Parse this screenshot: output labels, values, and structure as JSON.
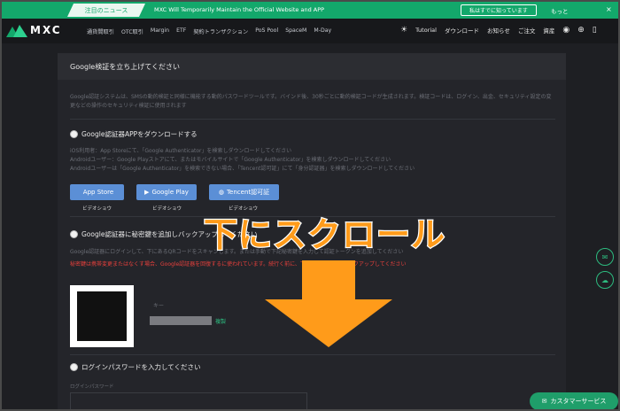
{
  "notice": {
    "tag": "注目のニュース",
    "text": "MXC Will Temporarily Maintain the Official Website and APP",
    "button": "私はすでに知っています",
    "more": "もっと",
    "close_glyph": "×"
  },
  "nav": {
    "logo": "MXC",
    "menu": [
      "通貨間取引",
      "OTC取引",
      "Margin",
      "ETF",
      "契約トランザクション",
      "PoS Pool",
      "SpaceM",
      "M-Day"
    ],
    "right": {
      "theme_icon": "sun-icon",
      "tutorial": "Tutorial",
      "download": "ダウンロード",
      "notice": "お知らせ",
      "orders": "ご注文",
      "assets": "資産"
    }
  },
  "panel": {
    "title": "Google検証を立ち上げてください",
    "description": "Google認証システムは、SMSの動的検証と同様に機能する動的パスワードツールです。バインド後、30秒ごとに動的検証コードが生成されます。検証コードは、ログイン、出金、セキュリティ設定の変更などの操作のセキュリティ検証に使用されます",
    "step1": {
      "label": "Google認証器APPをダウンロードする",
      "lines": [
        "iOS利用者：App Storeにて、「Google Authenticator」を検索しダウンロードしてください",
        "Androidユーザー：Google Playストアにて、またはモバイルサイトで「Google Authenticator」を検索しダウンロードしてください",
        "Androidユーザーは「Google Authenticator」を検索できない場合、「Tencent認可証」にて「身分認証器」を検索しダウンロードしてください"
      ],
      "buttons": [
        {
          "label": "App Store",
          "icon": "apple-icon",
          "caption": "ビデオショウ"
        },
        {
          "label": "Google Play",
          "icon": "play-icon",
          "caption": "ビデオショウ"
        },
        {
          "label": "Tencent認可証",
          "icon": "tencent-icon",
          "caption": "ビデオショウ"
        }
      ]
    },
    "step2": {
      "label": "Google認証器に秘密鍵を追加しバックアップしてください",
      "line": "Google認証器にログインして、下にあるQRコードをスキャンします。または手動で下記秘密鍵を入力して認証トークンを追加してください",
      "warning": "秘密鍵は携帯変更またはなくす場合、Google認証器を回復するに使われています。続行く前に、下記秘密鍵を必ずバックアップしてください",
      "key_label": "キー",
      "copy": "複製"
    },
    "step3": {
      "label": "ログインパスワードを入力してください",
      "field_label": "ログインパスワード"
    }
  },
  "overlay": {
    "text": "下にスクロール",
    "color": "#ff9b1a"
  },
  "floating": {
    "chat_icon": "chat-icon",
    "download_icon": "cloud-download-icon",
    "support_label": "カスタマーサービス"
  },
  "colors": {
    "brand_green": "#13a86b",
    "button_blue": "#5b8fd6",
    "warning_red": "#e8403c"
  }
}
